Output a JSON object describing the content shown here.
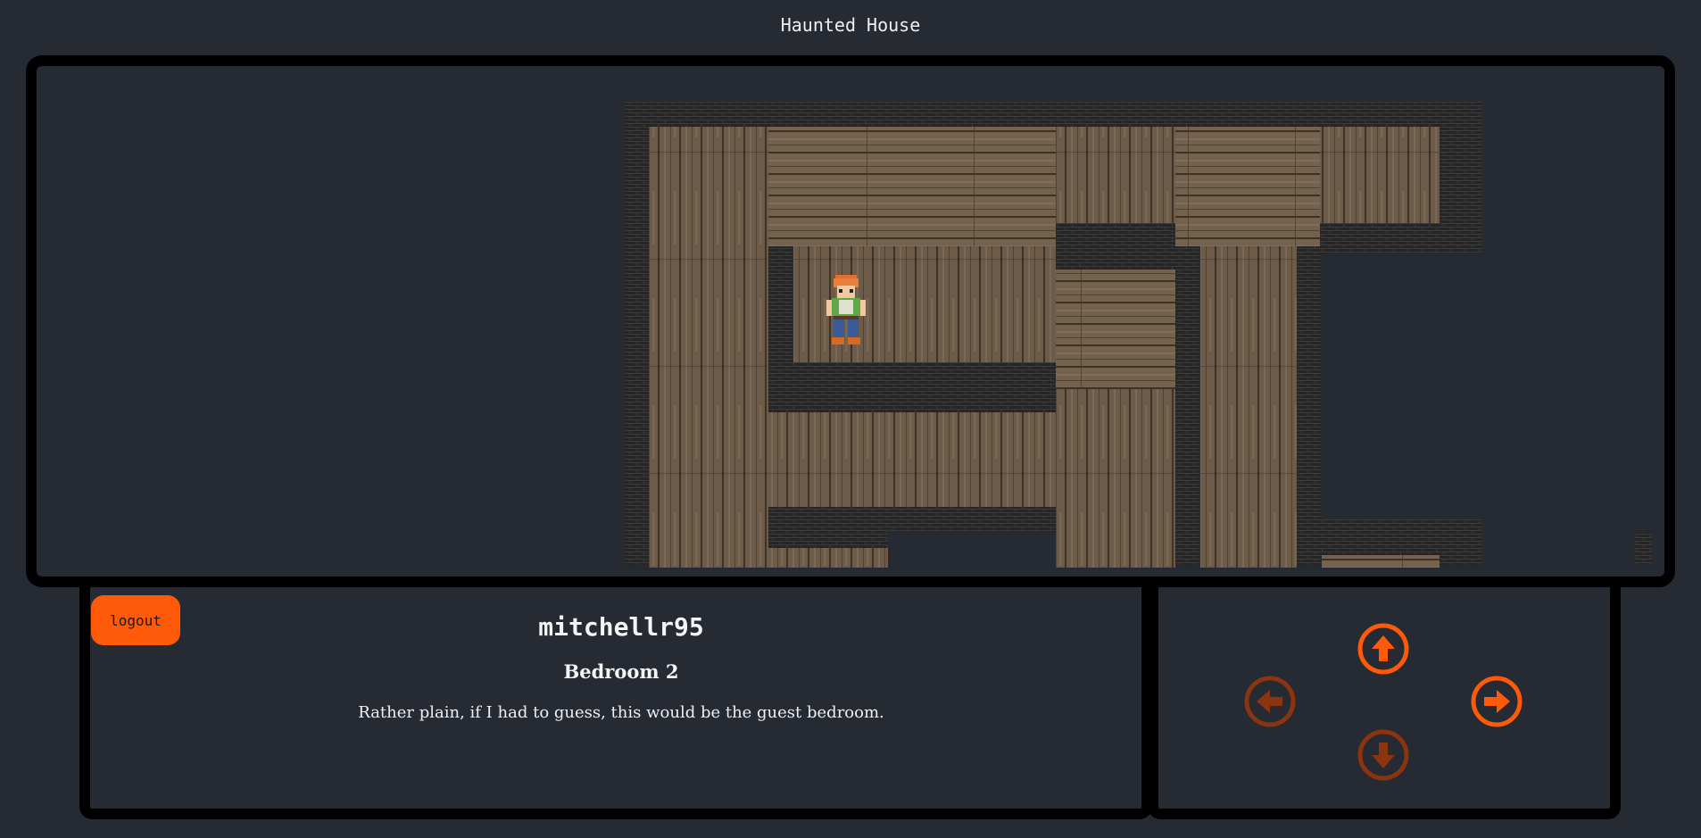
{
  "app": {
    "title": "Haunted House"
  },
  "player": {
    "username": "mitchellr95",
    "logout_label": "logout"
  },
  "room": {
    "name": "Bedroom 2",
    "description": "Rather plain, if I had to guess, this would be the guest bedroom."
  },
  "controls": {
    "north": {
      "icon": "arrow-up-circle-icon",
      "enabled": true
    },
    "south": {
      "icon": "arrow-down-circle-icon",
      "enabled": false
    },
    "west": {
      "icon": "arrow-left-circle-icon",
      "enabled": false
    },
    "east": {
      "icon": "arrow-right-circle-icon",
      "enabled": true
    }
  },
  "colors": {
    "background": "#252a33",
    "accent": "#ff5a0a",
    "accent_disabled": "#8a3410",
    "frame": "#000000",
    "wood": "#6e5d4a",
    "wall": "#262626"
  }
}
